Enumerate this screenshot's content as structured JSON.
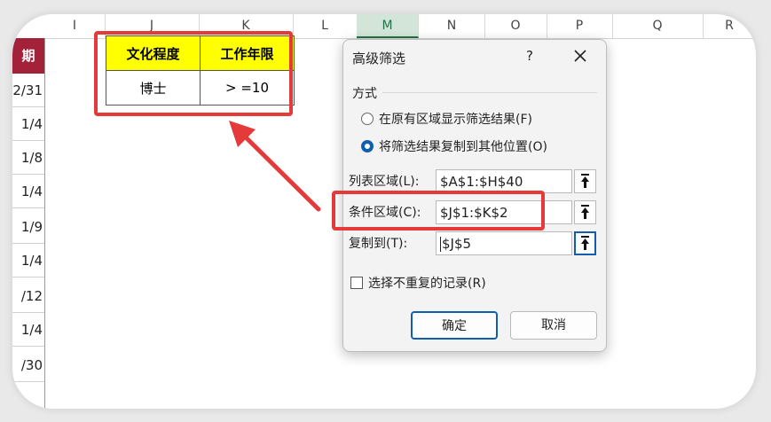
{
  "columns": [
    {
      "label": "I"
    },
    {
      "label": "J"
    },
    {
      "label": "K"
    },
    {
      "label": "L"
    },
    {
      "label": "M"
    },
    {
      "label": "N"
    },
    {
      "label": "O"
    },
    {
      "label": "P"
    },
    {
      "label": "Q"
    },
    {
      "label": "R"
    }
  ],
  "date_column": {
    "header": "期",
    "cells": [
      "2/31",
      "1/4",
      "1/8",
      "1/4",
      "1/9",
      "1/4",
      "/12",
      "1/4",
      "/30"
    ]
  },
  "criteria_table": {
    "headers": [
      "文化程度",
      "工作年限"
    ],
    "values": [
      "博士",
      "> =10"
    ]
  },
  "dialog": {
    "title": "高级筛选",
    "help": "?",
    "section_label": "方式",
    "radio_in_place": "在原有区域显示筛选结果(F)",
    "radio_copy": "将筛选结果复制到其他位置(O)",
    "list_range_label": "列表区域(L):",
    "list_range_value": "$A$1:$H$40",
    "criteria_range_label": "条件区域(C):",
    "criteria_range_value": "$J$1:$K$2",
    "copy_to_label": "复制到(T):",
    "copy_to_value": "$J$5",
    "unique_label": "选择不重复的记录(R)",
    "ok_label": "确定",
    "cancel_label": "取消"
  },
  "colors": {
    "accent_red": "#e43a3a",
    "header_yellow": "#ffff00",
    "dark_red": "#a4213a",
    "focus_blue": "#0f5fae",
    "selected_col_green": "#217346"
  }
}
